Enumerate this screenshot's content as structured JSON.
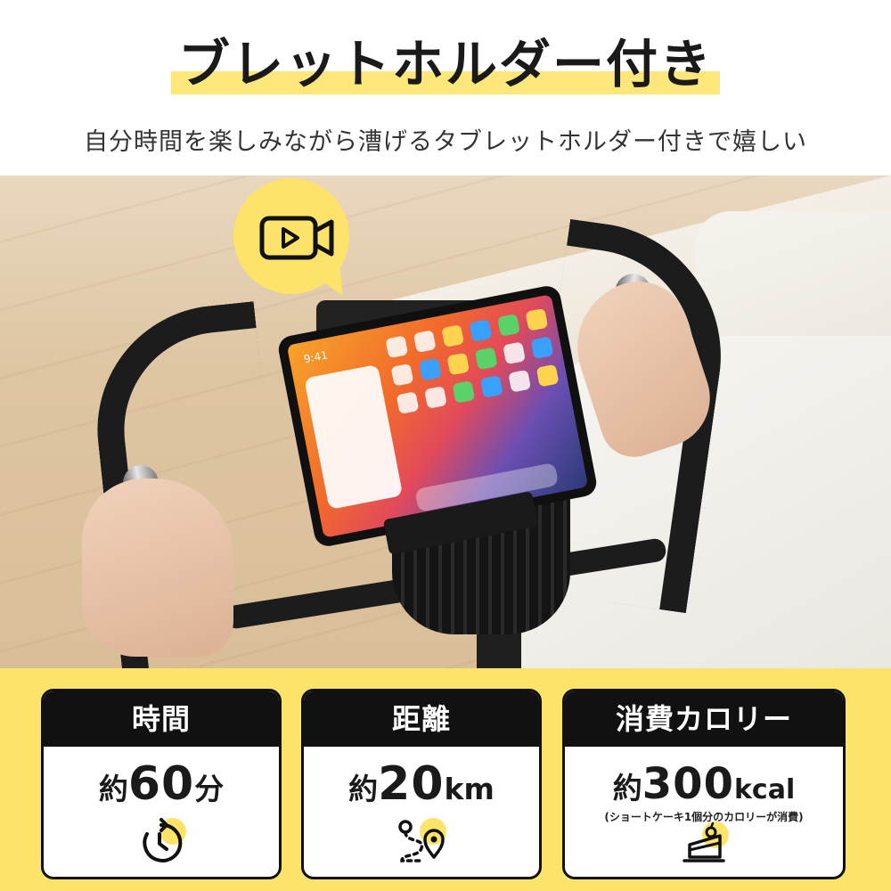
{
  "header": {
    "title": "ブレットホルダー付き",
    "subtitle": "自分時間を楽しみながら漕げるタブレットホルダー付きで嬉しい"
  },
  "photo": {
    "tablet_time": "9:41",
    "bubble_icon": "video-play-icon"
  },
  "stats": [
    {
      "label": "時間",
      "prefix": "約",
      "value": "60",
      "unit": "分",
      "note": "",
      "icon": "timer-icon"
    },
    {
      "label": "距離",
      "prefix": "約",
      "value": "20",
      "unit": "km",
      "note": "",
      "icon": "route-pin-icon"
    },
    {
      "label": "消費カロリー",
      "prefix": "約",
      "value": "300",
      "unit": "kcal",
      "note": "(ショートケーキ1個分のカロリーが消費)",
      "icon": "cake-icon"
    }
  ],
  "colors": {
    "accent_yellow": "#fde36a",
    "highlight": "#fde67a",
    "dark": "#111111"
  }
}
